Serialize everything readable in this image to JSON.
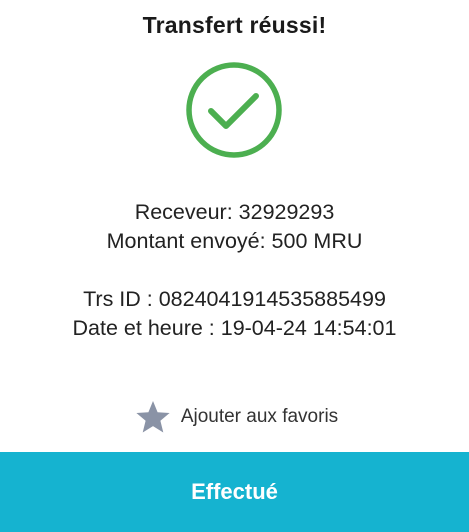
{
  "header": {
    "title": "Transfert réussi!"
  },
  "status": {
    "icon": "check-circle-icon",
    "color": "#4CAF50"
  },
  "details": {
    "receiver": "Receveur: 32929293",
    "amount": "Montant envoyé: 500 MRU",
    "transaction_id": "Trs ID : 0824041914535885499",
    "datetime": "Date et heure : 19-04-24 14:54:01"
  },
  "favorite": {
    "icon": "star-icon",
    "icon_color": "#8a93a6",
    "label": "Ajouter aux favoris"
  },
  "action": {
    "done_label": "Effectué",
    "color": "#15b3d0"
  }
}
